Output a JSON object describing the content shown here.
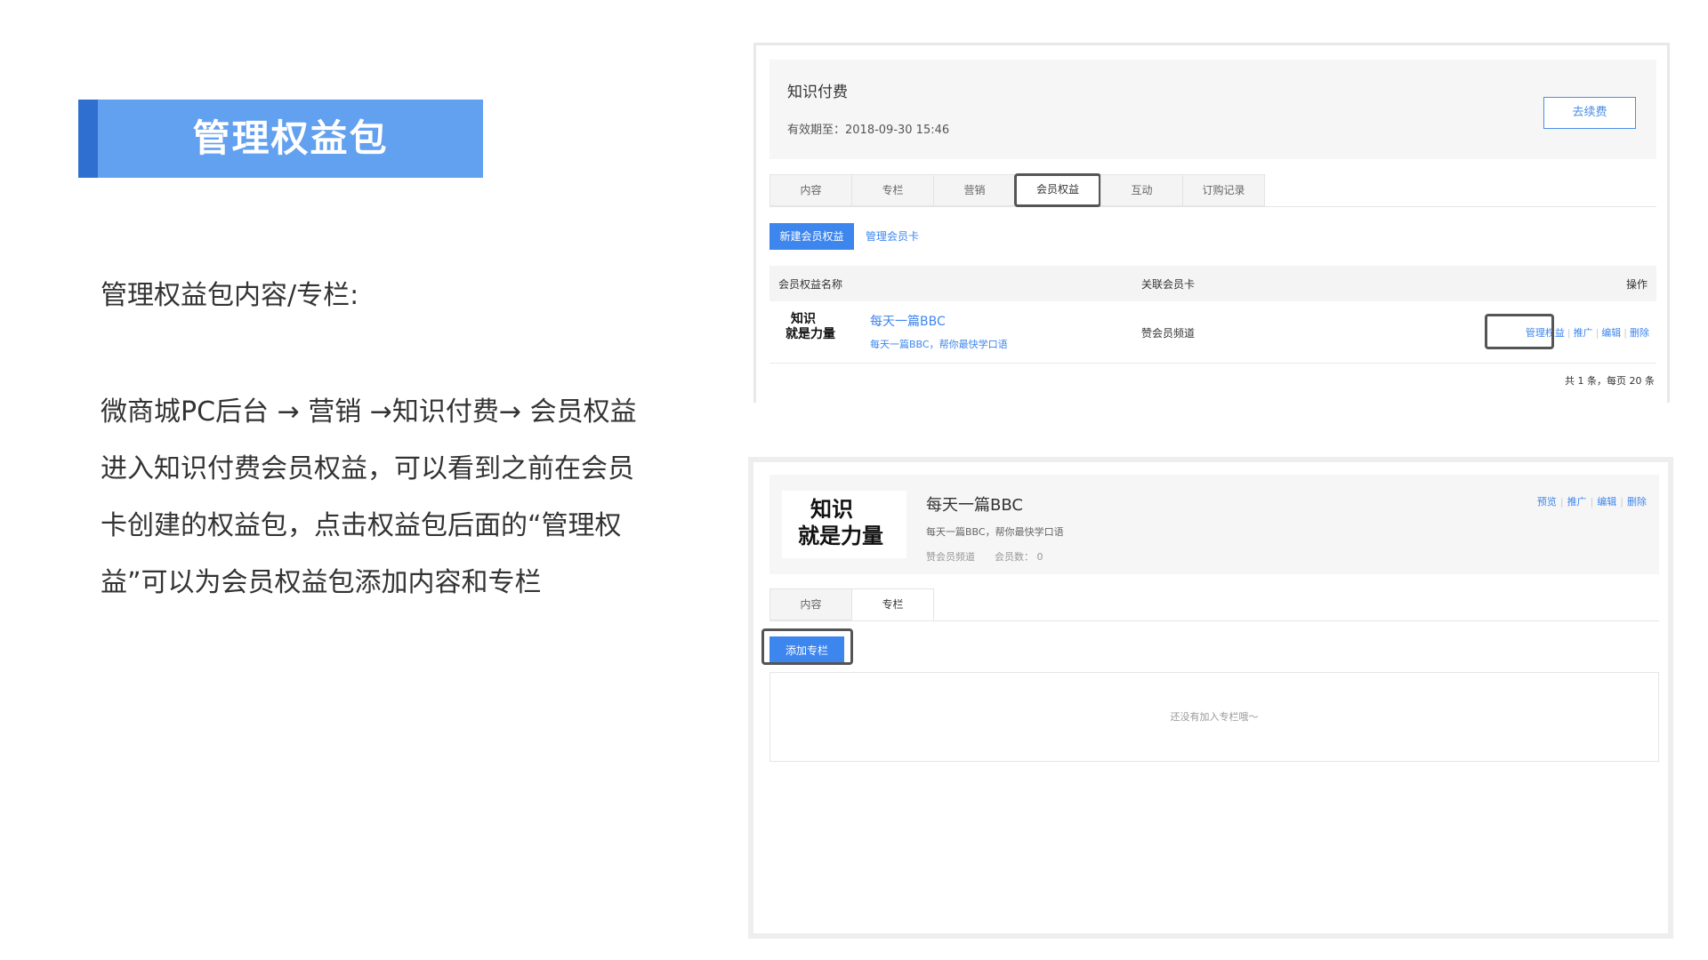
{
  "slide": {
    "title": "管理权益包",
    "section_heading": "管理权益包内容/专栏:",
    "description_lines": [
      "微商城PC后台 → 营销 →知识付费→ 会员权益",
      "进入知识付费会员权益，可以看到之前在会员",
      "卡创建的权益包，点击权益包后面的“管理权",
      "益”可以为会员权益包添加内容和专栏"
    ]
  },
  "screen1": {
    "header": {
      "title": "知识付费",
      "expiry": "有效期至：2018-09-30 15:46",
      "renew_button": "去续费"
    },
    "tabs": [
      "内容",
      "专栏",
      "营销",
      "会员权益",
      "互动",
      "订购记录"
    ],
    "active_tab": "会员权益",
    "new_button": "新建会员权益",
    "manage_card_link": "管理会员卡",
    "table": {
      "headers": [
        "会员权益名称",
        "关联会员卡",
        "操作"
      ],
      "rows": [
        {
          "logo_text": [
            "知识",
            "就是力量"
          ],
          "name": "每天一篇BBC",
          "subtitle": "每天一篇BBC，帮你最快学口语",
          "card": "赞会员频道",
          "actions": [
            "管理权益",
            "推广",
            "编辑",
            "删除"
          ]
        }
      ]
    },
    "pagination": "共 1 条，每页 20 条"
  },
  "screen2": {
    "header": {
      "logo_text": [
        "知识",
        "就是力量"
      ],
      "title": "每天一篇BBC",
      "subtitle": "每天一篇BBC，帮你最快学口语",
      "channel": "赞会员频道",
      "member_count": "会员数： 0",
      "actions": [
        "预览",
        "推广",
        "编辑",
        "删除"
      ]
    },
    "tabs": [
      "内容",
      "专栏"
    ],
    "active_tab": "专栏",
    "add_button": "添加专栏",
    "empty_text": "还没有加入专栏哦～"
  }
}
